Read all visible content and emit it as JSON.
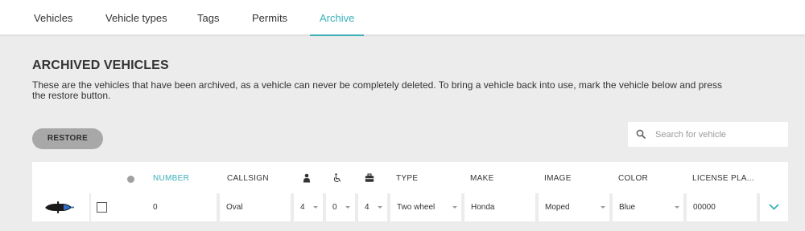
{
  "nav": {
    "tabs": [
      {
        "label": "Vehicles"
      },
      {
        "label": "Vehicle types"
      },
      {
        "label": "Tags"
      },
      {
        "label": "Permits"
      },
      {
        "label": "Archive"
      }
    ],
    "active_tab": "Archive"
  },
  "page": {
    "title": "ARCHIVED VEHICLES",
    "description": "These are the vehicles that have been archived, as a vehicle can never be completely deleted. To bring a vehicle back into use, mark the vehicle below and press the restore button."
  },
  "toolbar": {
    "restore_label": "RESTORE"
  },
  "search": {
    "placeholder": "Search for vehicle",
    "value": ""
  },
  "table": {
    "columns": {
      "number": "NUMBER",
      "callsign": "CALLSIGN",
      "type": "TYPE",
      "make": "MAKE",
      "image": "IMAGE",
      "color": "COLOR",
      "license_plate": "LICENSE PLA..."
    },
    "header_icons": [
      "status-dot-icon",
      "person-icon",
      "wheelchair-icon",
      "luggage-icon"
    ],
    "sorted_column": "NUMBER",
    "rows": [
      {
        "vehicle_icon": "moped-icon",
        "selected": false,
        "status_color": "#ee1111",
        "number": "0",
        "callsign": "Oval",
        "seats": "4",
        "wheelchairs": "0",
        "luggage": "4",
        "type": "Two wheel",
        "make": "Honda",
        "image": "Moped",
        "color": "Blue",
        "license_plate": "00000"
      }
    ]
  },
  "colors": {
    "accent": "#3ab0b9",
    "background": "#ececec",
    "button": "#a8a8a8",
    "status_inactive": "#a0a0a0"
  }
}
